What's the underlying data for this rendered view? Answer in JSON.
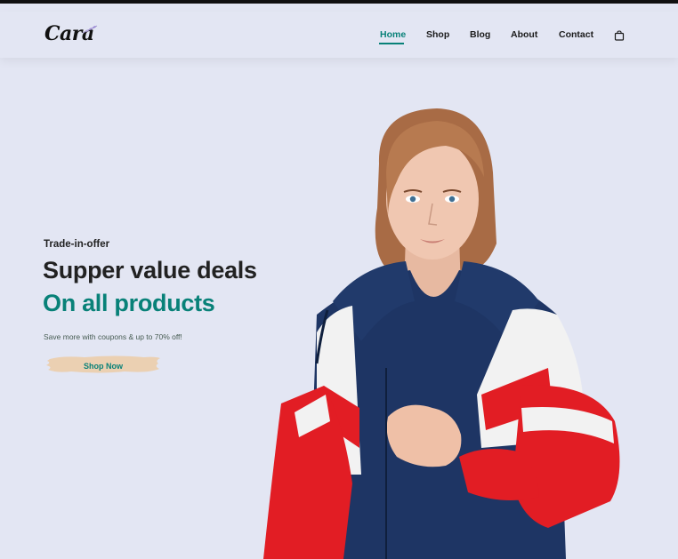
{
  "brand": {
    "logo_text": "Cara"
  },
  "nav": {
    "items": [
      {
        "label": "Home",
        "active": true
      },
      {
        "label": "Shop",
        "active": false
      },
      {
        "label": "Blog",
        "active": false
      },
      {
        "label": "About",
        "active": false
      },
      {
        "label": "Contact",
        "active": false
      }
    ],
    "cart_icon": "shopping-bag-icon"
  },
  "hero": {
    "subtitle": "Trade-in-offer",
    "heading": "Supper value deals",
    "heading_accent": "On all products",
    "description": "Save more with coupons & up to 70% off!",
    "button_label": "Shop Now",
    "image": "model-in-red-white-navy-windbreaker-jacket"
  },
  "colors": {
    "background": "#e3e6f3",
    "accent": "#088178",
    "text": "#222222",
    "button_brush": "#ebd0b2"
  }
}
